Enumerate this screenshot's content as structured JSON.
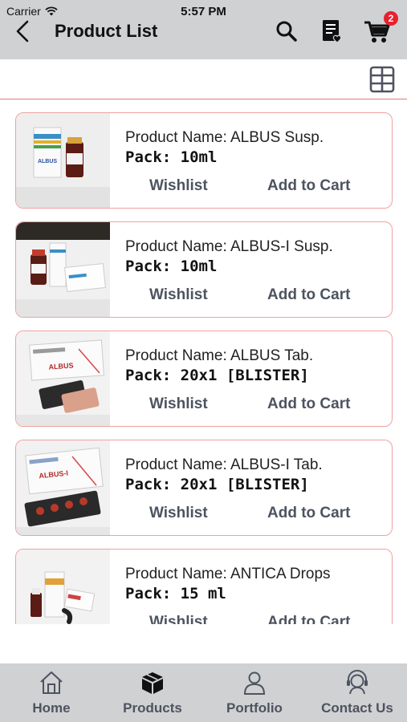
{
  "status_bar": {
    "carrier": "Carrier",
    "time": "5:57 PM"
  },
  "header": {
    "title": "Product List",
    "cart_count": "2"
  },
  "products": [
    {
      "name": "Product Name: ALBUS Susp.",
      "pack": "Pack: 10ml",
      "wishlist": "Wishlist",
      "add_to_cart": "Add to Cart"
    },
    {
      "name": "Product Name: ALBUS-I Susp.",
      "pack": "Pack: 10ml",
      "wishlist": "Wishlist",
      "add_to_cart": "Add to Cart"
    },
    {
      "name": "Product Name: ALBUS Tab.",
      "pack": "Pack: 20x1 [BLISTER]",
      "wishlist": "Wishlist",
      "add_to_cart": "Add to Cart"
    },
    {
      "name": "Product Name: ALBUS-I Tab.",
      "pack": "Pack: 20x1 [BLISTER]",
      "wishlist": "Wishlist",
      "add_to_cart": "Add to Cart"
    },
    {
      "name": "Product Name: ANTICA Drops",
      "pack": "Pack: 15 ml",
      "wishlist": "Wishlist",
      "add_to_cart": "Add to Cart"
    }
  ],
  "product_images": {
    "p1_box_label": "ALBUS",
    "p3_box_label": "ALBUS",
    "p4_box_label": "ALBUS-I"
  },
  "tabbar": {
    "home": "Home",
    "products": "Products",
    "portfolio": "Portfolio",
    "contact": "Contact Us"
  },
  "colors": {
    "header_bg": "#cfd1d3",
    "card_border": "#f0a1a1",
    "badge": "#e8212e",
    "action_text": "#4d5360"
  },
  "icons": {
    "back": "chevron-left-icon",
    "search": "search-icon",
    "wishlist_doc": "wishlist-document-icon",
    "cart": "cart-icon",
    "grid": "grid-view-icon"
  }
}
